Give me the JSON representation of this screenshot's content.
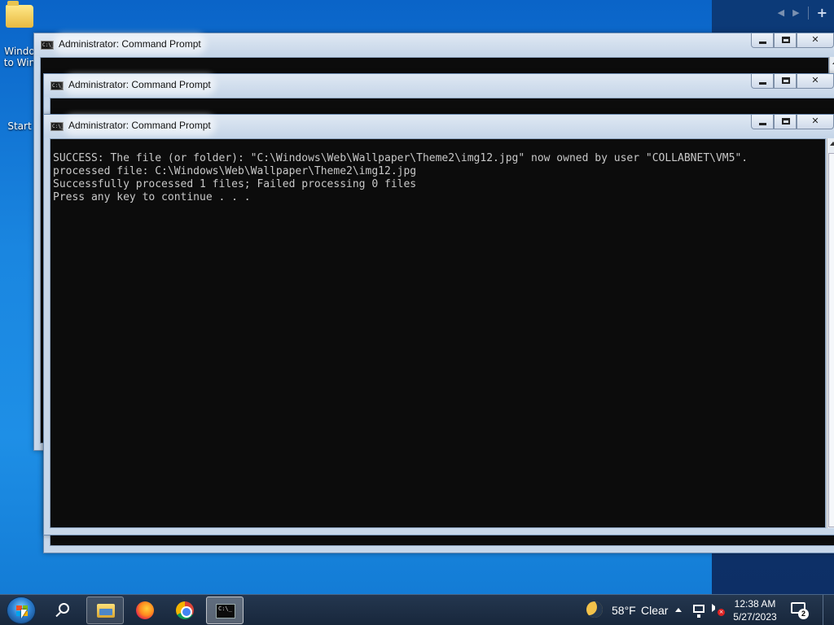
{
  "desktop": {
    "icons": [
      {
        "label_line1": "Windo",
        "label_line2": "to Win"
      },
      {
        "label_line1": "Start",
        "label_line2": ""
      }
    ]
  },
  "widget_nav": {
    "prev": "◀",
    "next": "▶",
    "add": "+"
  },
  "windows": [
    {
      "title": "Administrator:  Command Prompt",
      "icon_text": "C:\\_"
    },
    {
      "title": "Administrator:  Command Prompt",
      "icon_text": "C:\\_"
    },
    {
      "title": "Administrator:  Command Prompt",
      "icon_text": "C:\\_",
      "console_text": "SUCCESS: The file (or folder): \"C:\\Windows\\Web\\Wallpaper\\Theme2\\img12.jpg\" now owned by user \"COLLABNET\\VM5\".\nprocessed file: C:\\Windows\\Web\\Wallpaper\\Theme2\\img12.jpg\nSuccessfully processed 1 files; Failed processing 0 files\nPress any key to continue . . ."
    }
  ],
  "caption_buttons": {
    "close": "✕"
  },
  "taskbar": {
    "pinned": [
      "search-icon",
      "file-explorer-icon",
      "firefox-icon",
      "chrome-icon",
      "command-prompt-icon"
    ],
    "cmd_glyph_text": "C:\\_"
  },
  "tray": {
    "temperature": "58°F",
    "condition": "Clear",
    "time": "12:38 AM",
    "date": "5/27/2023",
    "notification_count": "2"
  }
}
